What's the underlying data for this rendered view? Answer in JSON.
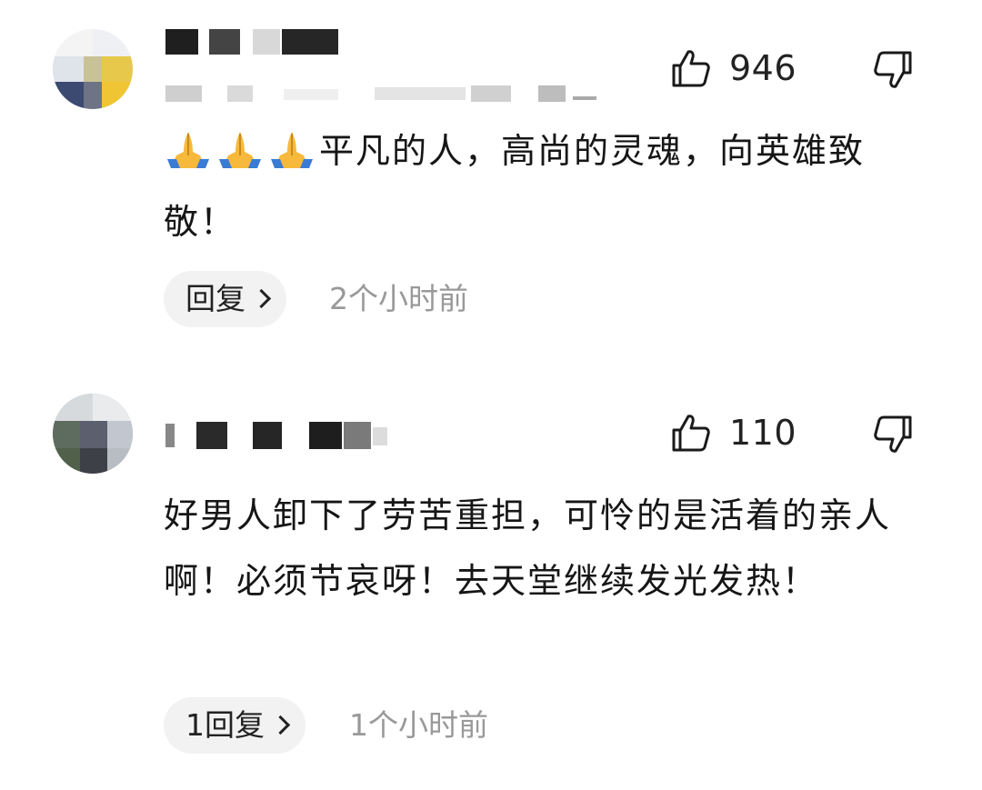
{
  "comments": [
    {
      "like_count": "946",
      "text": "平凡的人，高尚的灵魂，向英雄致敬！",
      "emoji": "pray-emoji",
      "reply_label": "回复",
      "time": "2个小时前"
    },
    {
      "like_count": "110",
      "text": "好男人卸下了劳苦重担，可怜的是活着的亲人啊！必须节哀呀！去天堂继续发光发热！",
      "reply_label": "1回复",
      "time": "1个小时前"
    }
  ],
  "icons": {
    "like": "thumbs-up-icon",
    "dislike": "thumbs-down-icon",
    "reply_chevron": "chevron-right-icon"
  },
  "colors": {
    "text": "#161616",
    "secondary": "#999999",
    "reply_bg": "#f2f2f2"
  }
}
